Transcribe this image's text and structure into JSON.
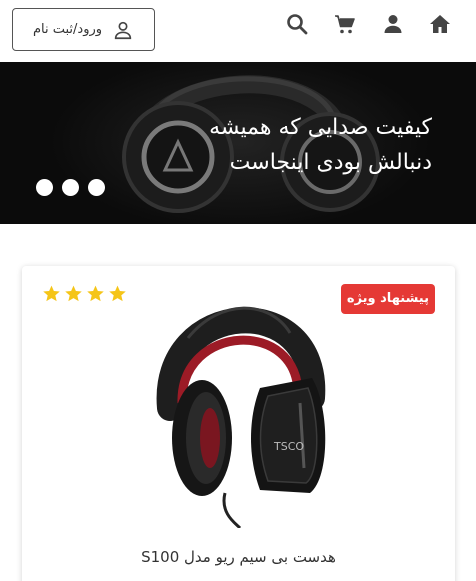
{
  "header": {
    "login_label": "ورود/ثبت نام"
  },
  "hero": {
    "line1": "کیفیت صدایی که همیشه",
    "line2": "دنبالش بودی اینجاست"
  },
  "product": {
    "badge": "پیشنهاد ویژه",
    "rating": 4,
    "rating_max": 4,
    "title": "هدست بی سیم ریو مدل S100"
  },
  "colors": {
    "badge": "#e53935",
    "star": "#f5c518",
    "hero_bg": "#0b0b0b"
  }
}
